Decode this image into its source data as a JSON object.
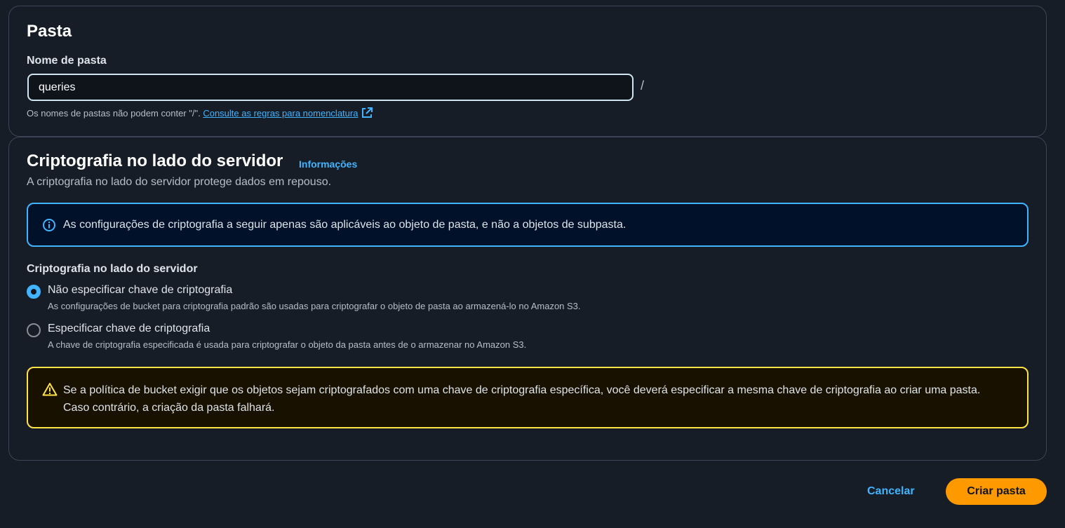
{
  "folder_section": {
    "title": "Pasta",
    "name_label": "Nome de pasta",
    "name_value": "queries",
    "slash": "/",
    "hint_text": "Os nomes de pastas não podem conter \"/\".",
    "hint_link": "Consulte as regras para nomenclatura"
  },
  "encryption_section": {
    "title": "Criptografia no lado do servidor",
    "info_link": "Informações",
    "description": "A criptografia no lado do servidor protege dados em repouso.",
    "info_alert": "As configurações de criptografia a seguir apenas são aplicáveis ao objeto de pasta, e não a objetos de subpasta.",
    "radio_group_label": "Criptografia no lado do servidor",
    "options": [
      {
        "label": "Não especificar chave de criptografia",
        "description": "As configurações de bucket para criptografia padrão são usadas para criptografar o objeto de pasta ao armazená-lo no Amazon S3.",
        "selected": true
      },
      {
        "label": "Especificar chave de criptografia",
        "description": "A chave de criptografia especificada é usada para criptografar o objeto da pasta antes de o armazenar no Amazon S3.",
        "selected": false
      }
    ],
    "warning_alert": "Se a política de bucket exigir que os objetos sejam criptografados com uma chave de criptografia específica, você deverá especificar a mesma chave de criptografia ao criar uma pasta. Caso contrário, a criação da pasta falhará."
  },
  "footer": {
    "cancel_label": "Cancelar",
    "create_label": "Criar pasta"
  },
  "colors": {
    "background": "#161d26",
    "link": "#42b4ff",
    "primary_button": "#ff9900",
    "info_border": "#42b4ff",
    "warning_border": "#ffe347"
  },
  "icons": {
    "external_link": "external-link-icon",
    "info": "info-icon",
    "warning": "warning-icon"
  }
}
